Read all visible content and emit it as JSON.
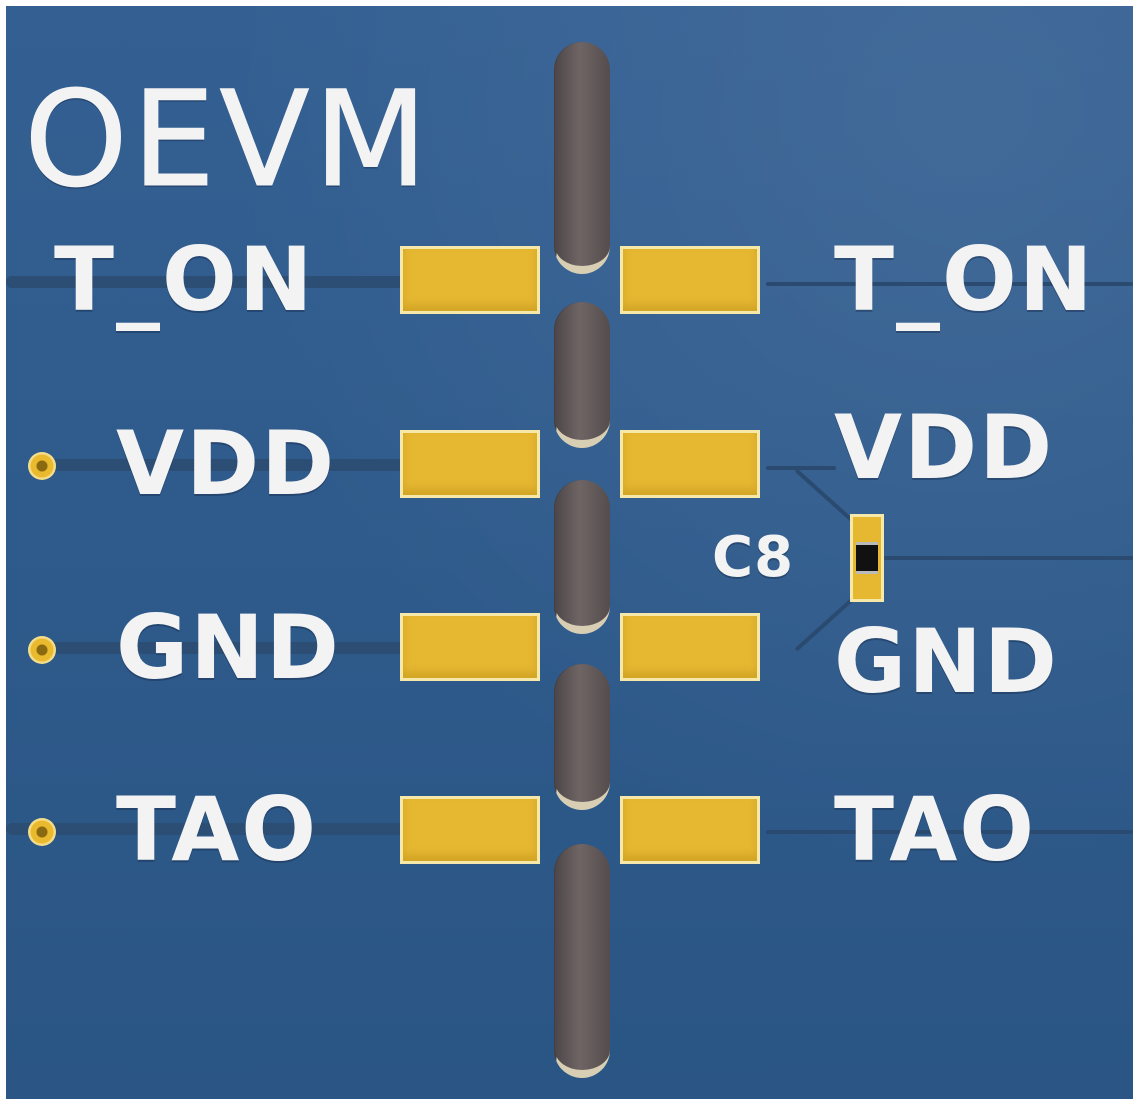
{
  "board_title": "OEVM",
  "left_labels": [
    "T_ON",
    "VDD",
    "GND",
    "TAO"
  ],
  "right_labels": [
    "T_ON",
    "VDD",
    "GND",
    "TAO"
  ],
  "component": {
    "ref": "C8"
  },
  "colors": {
    "board": "#2f5d8f",
    "pad": "#e6b731",
    "silkscreen": "#f3f3f3",
    "slot": "#5e5556"
  }
}
